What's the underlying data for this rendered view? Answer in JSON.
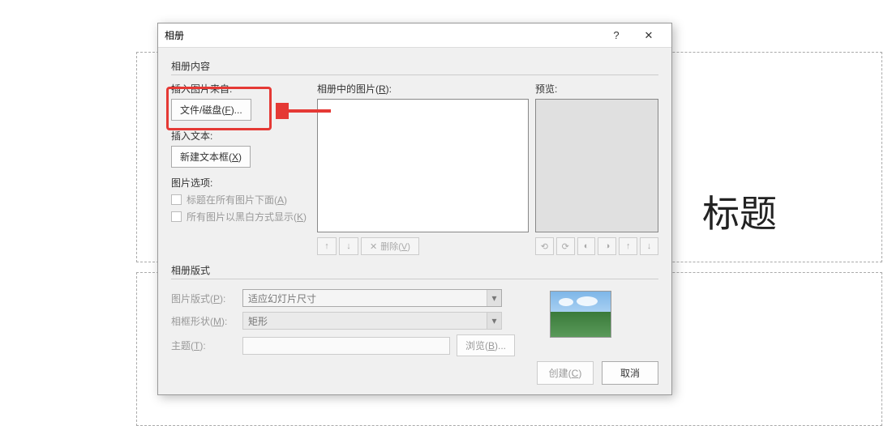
{
  "background": {
    "slide_title": "标题"
  },
  "dialog": {
    "title": "相册",
    "help": "?",
    "close": "✕",
    "content_group": "相册内容",
    "insert_from": "插入图片来自:",
    "file_disk_btn": "文件/磁盘(F)...",
    "insert_text": "插入文本:",
    "new_textbox_btn": "新建文本框(X)",
    "pic_options": "图片选项:",
    "caption_below": "标题在所有图片下面(A)",
    "bw_display": "所有图片以黑白方式显示(K)",
    "pics_in_album": "相册中的图片(R):",
    "preview": "预览:",
    "up_icon": "↑",
    "down_icon": "↓",
    "remove_btn": "删除(V)",
    "remove_x": "✕",
    "layout_group": "相册版式",
    "pic_layout": "图片版式(P):",
    "pic_layout_val": "适应幻灯片尺寸",
    "frame_shape": "相框形状(M):",
    "frame_shape_val": "矩形",
    "theme": "主题(T):",
    "browse_btn": "浏览(B)...",
    "create_btn": "创建(C)",
    "cancel_btn": "取消"
  }
}
